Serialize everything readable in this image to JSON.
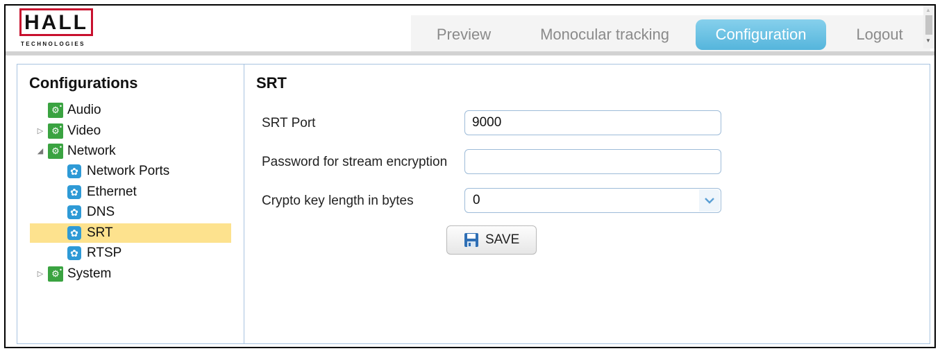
{
  "brand": {
    "logo_text": "HALL",
    "logo_subtext": "TECHNOLOGIES",
    "accent_color": "#c8102e"
  },
  "nav": {
    "items": [
      {
        "label": "Preview",
        "active": false
      },
      {
        "label": "Monocular tracking",
        "active": false
      },
      {
        "label": "Configuration",
        "active": true
      },
      {
        "label": "Logout",
        "active": false
      }
    ],
    "active_color": "#6bc3e4"
  },
  "sidebar": {
    "title": "Configurations",
    "tree": [
      {
        "label": "Audio",
        "icon": "gear-icon",
        "expander": "none"
      },
      {
        "label": "Video",
        "icon": "gear-icon",
        "expander": "collapsed"
      },
      {
        "label": "Network",
        "icon": "gear-icon",
        "expander": "expanded"
      },
      {
        "label": "Network Ports",
        "icon": "cog-icon"
      },
      {
        "label": "Ethernet",
        "icon": "cog-icon"
      },
      {
        "label": "DNS",
        "icon": "cog-icon"
      },
      {
        "label": "SRT",
        "icon": "cog-icon",
        "selected": true
      },
      {
        "label": "RTSP",
        "icon": "cog-icon"
      },
      {
        "label": "System",
        "icon": "gear-icon",
        "expander": "collapsed"
      }
    ],
    "selected_color": "#fde28e"
  },
  "panel": {
    "title": "SRT",
    "fields": {
      "srt_port": {
        "label": "SRT Port",
        "value": "9000"
      },
      "password": {
        "label": "Password for stream encryption",
        "value": ""
      },
      "crypto_key": {
        "label": "Crypto key length in bytes",
        "value": "0"
      }
    },
    "save_label": "SAVE"
  }
}
